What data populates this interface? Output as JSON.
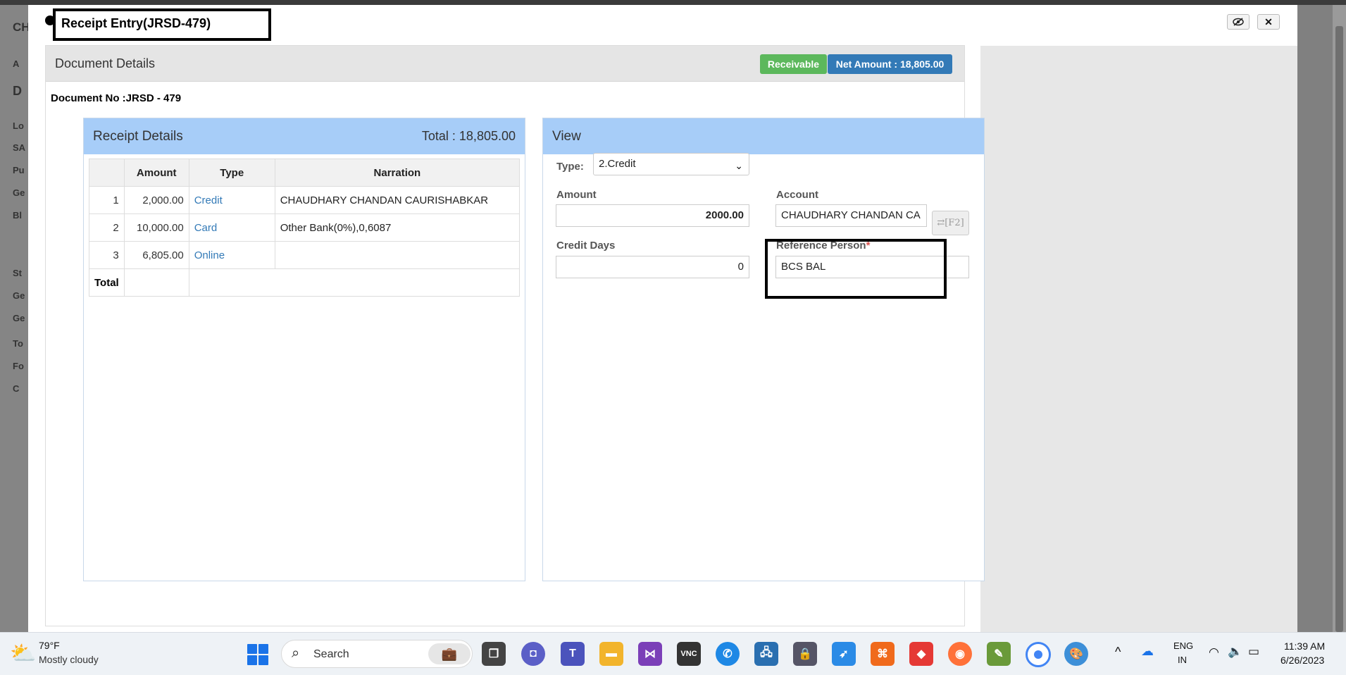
{
  "modal": {
    "title": "Receipt Entry(JRSD-479)",
    "header_buttons": [
      "eye-slash-icon",
      "close-icon"
    ]
  },
  "document": {
    "section_title": "Document Details",
    "badge_receivable": "Receivable",
    "badge_net_amount": "Net Amount :  18,805.00",
    "doc_no": "Document No :JRSD - 479"
  },
  "receipt_details": {
    "title": "Receipt Details",
    "total_label": "Total :  18,805.00",
    "columns": [
      "",
      "Amount",
      "Type",
      "Narration"
    ],
    "rows": [
      {
        "n": "1",
        "amount": "2,000.00",
        "type": "Credit",
        "narration": "CHAUDHARY CHANDAN CAURISHABKAR"
      },
      {
        "n": "2",
        "amount": "10,000.00",
        "type": "Card",
        "narration": "Other Bank(0%),0,6087"
      },
      {
        "n": "3",
        "amount": "6,805.00",
        "type": "Online",
        "narration": ""
      }
    ],
    "total_row_label": "Total"
  },
  "view": {
    "title": "View",
    "type_label": "Type:",
    "type_value": "2.Credit",
    "amount_label": "Amount",
    "amount_value": "2000.00",
    "account_label": "Account",
    "account_value": "CHAUDHARY CHANDAN CA",
    "account_lookup_label": "[F2]",
    "credit_days_label": "Credit Days",
    "credit_days_value": "0",
    "ref_person_label": "Reference Person",
    "ref_person_required": "*",
    "ref_person_value": "BCS BAL"
  },
  "background_app": {
    "letters": [
      "CH",
      "A",
      "D",
      "Lo",
      "SA",
      "Pu",
      "Ge",
      "Bl",
      "St",
      "Ge",
      "Ge",
      "To",
      "Fo",
      "C"
    ]
  },
  "taskbar": {
    "weather_temp": "79°F",
    "weather_desc": "Mostly cloudy",
    "search_placeholder": "Search",
    "lang_line1": "ENG",
    "lang_line2": "IN",
    "time": "11:39 AM",
    "date": "6/26/2023"
  },
  "colors": {
    "panel_header": "#a7cdf8",
    "badge_green": "#5cb85c",
    "badge_blue": "#337ab7",
    "link_blue": "#337ab7"
  }
}
